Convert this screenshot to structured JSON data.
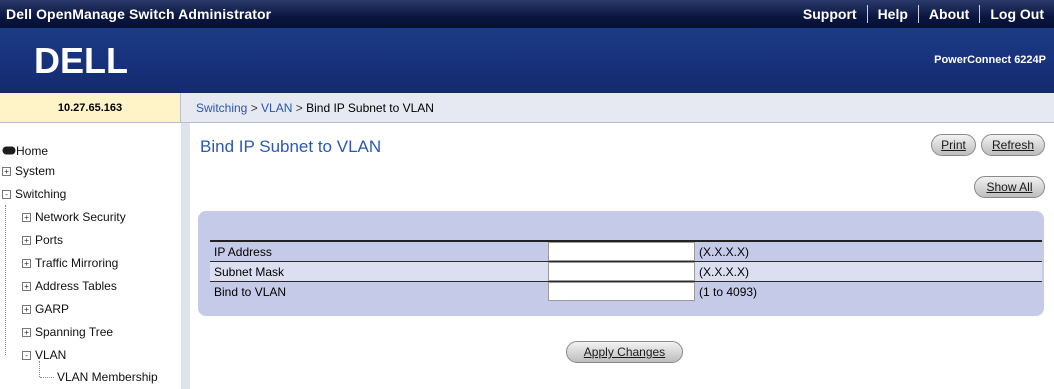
{
  "topbar": {
    "title": "Dell OpenManage Switch Administrator",
    "menu": [
      "Support",
      "Help",
      "About",
      "Log Out"
    ]
  },
  "brand": {
    "logo": "DELL",
    "product": "PowerConnect 6224P"
  },
  "ip_address": "10.27.65.163",
  "breadcrumb": [
    "Switching",
    "VLAN",
    "Bind IP Subnet to VLAN"
  ],
  "sidebar": {
    "items": [
      {
        "label": "Home",
        "icon": "home-icon"
      },
      {
        "label": "System",
        "expander": "+"
      },
      {
        "label": "Switching",
        "expander": "-"
      },
      {
        "label": "Network Security",
        "expander": "+"
      },
      {
        "label": "Ports",
        "expander": "+"
      },
      {
        "label": "Traffic Mirroring",
        "expander": "+"
      },
      {
        "label": "Address Tables",
        "expander": "+"
      },
      {
        "label": "GARP",
        "expander": "+"
      },
      {
        "label": "Spanning Tree",
        "expander": "+"
      },
      {
        "label": "VLAN",
        "expander": "-"
      },
      {
        "label": "VLAN Membership"
      }
    ]
  },
  "page": {
    "title": "Bind IP Subnet to VLAN",
    "buttons": {
      "print": "Print",
      "refresh": "Refresh",
      "show_all": "Show All",
      "apply": "Apply Changes"
    }
  },
  "form": {
    "rows": [
      {
        "label": "IP Address",
        "value": "",
        "hint": "(X.X.X.X)"
      },
      {
        "label": "Subnet Mask",
        "value": "",
        "hint": "(X.X.X.X)"
      },
      {
        "label": "Bind to VLAN",
        "value": "",
        "hint": "(1 to 4093)"
      }
    ]
  },
  "colors": {
    "header_dark": "#0b1640",
    "brand_blue": "#17307a",
    "title_blue": "#2a58b8",
    "panel": "#c5cae9",
    "ip_cell": "#fff4c8"
  }
}
